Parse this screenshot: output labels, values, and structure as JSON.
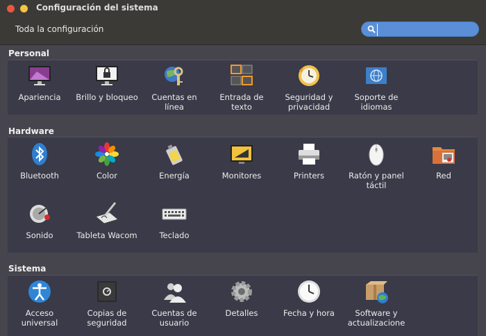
{
  "window": {
    "title": "Configuración del sistema"
  },
  "toolbar": {
    "all_settings": "Toda la configuración",
    "search_value": ""
  },
  "sections": {
    "personal": {
      "title": "Personal",
      "items": [
        {
          "label": "Apariencia",
          "icon": "appearance-icon"
        },
        {
          "label": "Brillo y bloqueo",
          "icon": "brightness-lock-icon"
        },
        {
          "label": "Cuentas en línea",
          "icon": "online-accounts-icon"
        },
        {
          "label": "Entrada de texto",
          "icon": "text-entry-icon"
        },
        {
          "label": "Seguridad y privacidad",
          "icon": "security-privacy-icon"
        },
        {
          "label": "Soporte de idiomas",
          "icon": "language-support-icon"
        }
      ]
    },
    "hardware": {
      "title": "Hardware",
      "items": [
        {
          "label": "Bluetooth",
          "icon": "bluetooth-icon"
        },
        {
          "label": "Color",
          "icon": "color-icon"
        },
        {
          "label": "Energía",
          "icon": "power-icon"
        },
        {
          "label": "Monitores",
          "icon": "displays-icon"
        },
        {
          "label": "Printers",
          "icon": "printer-icon"
        },
        {
          "label": "Ratón y panel táctil",
          "icon": "mouse-touchpad-icon"
        },
        {
          "label": "Red",
          "icon": "network-icon"
        },
        {
          "label": "Sonido",
          "icon": "sound-icon"
        },
        {
          "label": "Tableta Wacom",
          "icon": "wacom-tablet-icon"
        },
        {
          "label": "Teclado",
          "icon": "keyboard-icon"
        }
      ]
    },
    "system": {
      "title": "Sistema",
      "items": [
        {
          "label": "Acceso universal",
          "icon": "universal-access-icon"
        },
        {
          "label": "Copias de seguridad",
          "icon": "backups-icon"
        },
        {
          "label": "Cuentas de usuario",
          "icon": "user-accounts-icon"
        },
        {
          "label": "Detalles",
          "icon": "details-icon"
        },
        {
          "label": "Fecha y hora",
          "icon": "date-time-icon"
        },
        {
          "label": "Software y actualizacione",
          "icon": "software-updates-icon"
        }
      ]
    }
  }
}
